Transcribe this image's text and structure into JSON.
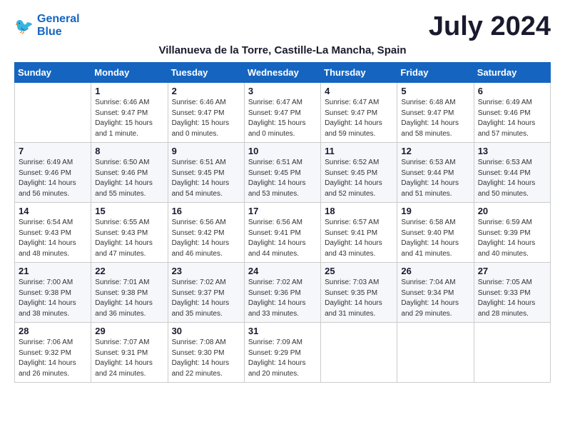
{
  "logo": {
    "line1": "General",
    "line2": "Blue"
  },
  "title": "July 2024",
  "subtitle": "Villanueva de la Torre, Castille-La Mancha, Spain",
  "days_of_week": [
    "Sunday",
    "Monday",
    "Tuesday",
    "Wednesday",
    "Thursday",
    "Friday",
    "Saturday"
  ],
  "weeks": [
    [
      {
        "day": "",
        "info": ""
      },
      {
        "day": "1",
        "info": "Sunrise: 6:46 AM\nSunset: 9:47 PM\nDaylight: 15 hours\nand 1 minute."
      },
      {
        "day": "2",
        "info": "Sunrise: 6:46 AM\nSunset: 9:47 PM\nDaylight: 15 hours\nand 0 minutes."
      },
      {
        "day": "3",
        "info": "Sunrise: 6:47 AM\nSunset: 9:47 PM\nDaylight: 15 hours\nand 0 minutes."
      },
      {
        "day": "4",
        "info": "Sunrise: 6:47 AM\nSunset: 9:47 PM\nDaylight: 14 hours\nand 59 minutes."
      },
      {
        "day": "5",
        "info": "Sunrise: 6:48 AM\nSunset: 9:47 PM\nDaylight: 14 hours\nand 58 minutes."
      },
      {
        "day": "6",
        "info": "Sunrise: 6:49 AM\nSunset: 9:46 PM\nDaylight: 14 hours\nand 57 minutes."
      }
    ],
    [
      {
        "day": "7",
        "info": "Sunrise: 6:49 AM\nSunset: 9:46 PM\nDaylight: 14 hours\nand 56 minutes."
      },
      {
        "day": "8",
        "info": "Sunrise: 6:50 AM\nSunset: 9:46 PM\nDaylight: 14 hours\nand 55 minutes."
      },
      {
        "day": "9",
        "info": "Sunrise: 6:51 AM\nSunset: 9:45 PM\nDaylight: 14 hours\nand 54 minutes."
      },
      {
        "day": "10",
        "info": "Sunrise: 6:51 AM\nSunset: 9:45 PM\nDaylight: 14 hours\nand 53 minutes."
      },
      {
        "day": "11",
        "info": "Sunrise: 6:52 AM\nSunset: 9:45 PM\nDaylight: 14 hours\nand 52 minutes."
      },
      {
        "day": "12",
        "info": "Sunrise: 6:53 AM\nSunset: 9:44 PM\nDaylight: 14 hours\nand 51 minutes."
      },
      {
        "day": "13",
        "info": "Sunrise: 6:53 AM\nSunset: 9:44 PM\nDaylight: 14 hours\nand 50 minutes."
      }
    ],
    [
      {
        "day": "14",
        "info": "Sunrise: 6:54 AM\nSunset: 9:43 PM\nDaylight: 14 hours\nand 48 minutes."
      },
      {
        "day": "15",
        "info": "Sunrise: 6:55 AM\nSunset: 9:43 PM\nDaylight: 14 hours\nand 47 minutes."
      },
      {
        "day": "16",
        "info": "Sunrise: 6:56 AM\nSunset: 9:42 PM\nDaylight: 14 hours\nand 46 minutes."
      },
      {
        "day": "17",
        "info": "Sunrise: 6:56 AM\nSunset: 9:41 PM\nDaylight: 14 hours\nand 44 minutes."
      },
      {
        "day": "18",
        "info": "Sunrise: 6:57 AM\nSunset: 9:41 PM\nDaylight: 14 hours\nand 43 minutes."
      },
      {
        "day": "19",
        "info": "Sunrise: 6:58 AM\nSunset: 9:40 PM\nDaylight: 14 hours\nand 41 minutes."
      },
      {
        "day": "20",
        "info": "Sunrise: 6:59 AM\nSunset: 9:39 PM\nDaylight: 14 hours\nand 40 minutes."
      }
    ],
    [
      {
        "day": "21",
        "info": "Sunrise: 7:00 AM\nSunset: 9:38 PM\nDaylight: 14 hours\nand 38 minutes."
      },
      {
        "day": "22",
        "info": "Sunrise: 7:01 AM\nSunset: 9:38 PM\nDaylight: 14 hours\nand 36 minutes."
      },
      {
        "day": "23",
        "info": "Sunrise: 7:02 AM\nSunset: 9:37 PM\nDaylight: 14 hours\nand 35 minutes."
      },
      {
        "day": "24",
        "info": "Sunrise: 7:02 AM\nSunset: 9:36 PM\nDaylight: 14 hours\nand 33 minutes."
      },
      {
        "day": "25",
        "info": "Sunrise: 7:03 AM\nSunset: 9:35 PM\nDaylight: 14 hours\nand 31 minutes."
      },
      {
        "day": "26",
        "info": "Sunrise: 7:04 AM\nSunset: 9:34 PM\nDaylight: 14 hours\nand 29 minutes."
      },
      {
        "day": "27",
        "info": "Sunrise: 7:05 AM\nSunset: 9:33 PM\nDaylight: 14 hours\nand 28 minutes."
      }
    ],
    [
      {
        "day": "28",
        "info": "Sunrise: 7:06 AM\nSunset: 9:32 PM\nDaylight: 14 hours\nand 26 minutes."
      },
      {
        "day": "29",
        "info": "Sunrise: 7:07 AM\nSunset: 9:31 PM\nDaylight: 14 hours\nand 24 minutes."
      },
      {
        "day": "30",
        "info": "Sunrise: 7:08 AM\nSunset: 9:30 PM\nDaylight: 14 hours\nand 22 minutes."
      },
      {
        "day": "31",
        "info": "Sunrise: 7:09 AM\nSunset: 9:29 PM\nDaylight: 14 hours\nand 20 minutes."
      },
      {
        "day": "",
        "info": ""
      },
      {
        "day": "",
        "info": ""
      },
      {
        "day": "",
        "info": ""
      }
    ]
  ]
}
